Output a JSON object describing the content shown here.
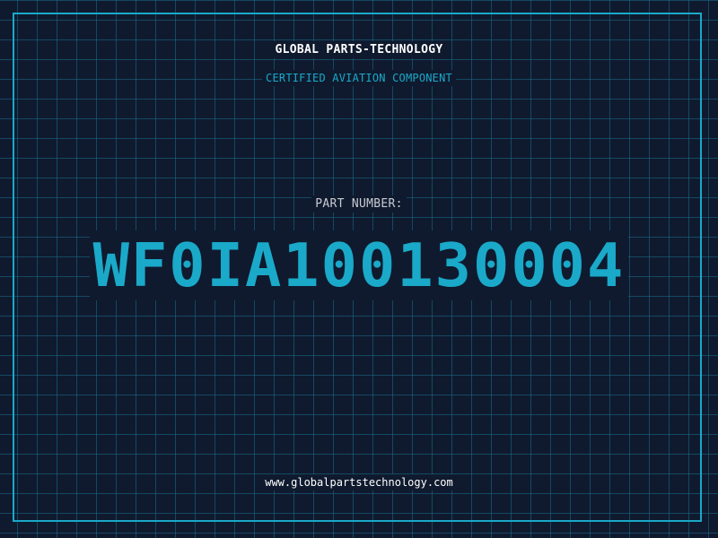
{
  "header": {
    "company_name": "GLOBAL PARTS-TECHNOLOGY",
    "tagline": "CERTIFIED AVIATION COMPONENT"
  },
  "part": {
    "label": "PART NUMBER:",
    "number": "WF0IA100130004"
  },
  "footer": {
    "website": "www.globalpartstechnology.com"
  },
  "colors": {
    "background": "#0f1a2e",
    "accent": "#1aa9c9",
    "text": "#ffffff",
    "muted_text": "#c8cbd2"
  }
}
